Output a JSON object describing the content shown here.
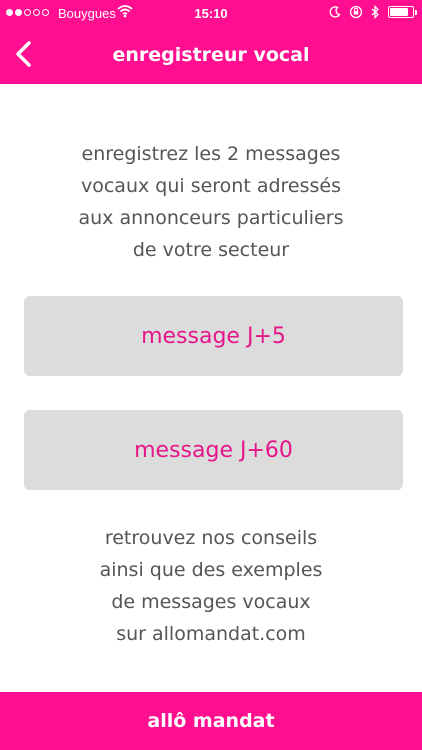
{
  "status_bar": {
    "carrier": "Bouygues",
    "time": "15:10",
    "signal_bars_filled": 2,
    "signal_bars_total": 5,
    "battery_level": 0.85
  },
  "header": {
    "title": "enregistreur vocal",
    "back_icon": "chevron-left-icon",
    "background_color": "#ff0f8f"
  },
  "intro": {
    "lines": [
      "enregistrez les 2 messages",
      "vocaux qui seront adressés",
      "aux annonceurs particuliers",
      "de votre secteur"
    ]
  },
  "buttons": {
    "message_j5": "message J+5",
    "message_j60": "message J+60",
    "button_bg": "#dcdcdc",
    "button_text_color": "#e6168a"
  },
  "tips": {
    "lines": [
      "retrouvez nos conseils",
      "ainsi que des exemples",
      "de messages vocaux",
      "sur allomandat.com"
    ]
  },
  "footer": {
    "label": "allô mandat"
  }
}
